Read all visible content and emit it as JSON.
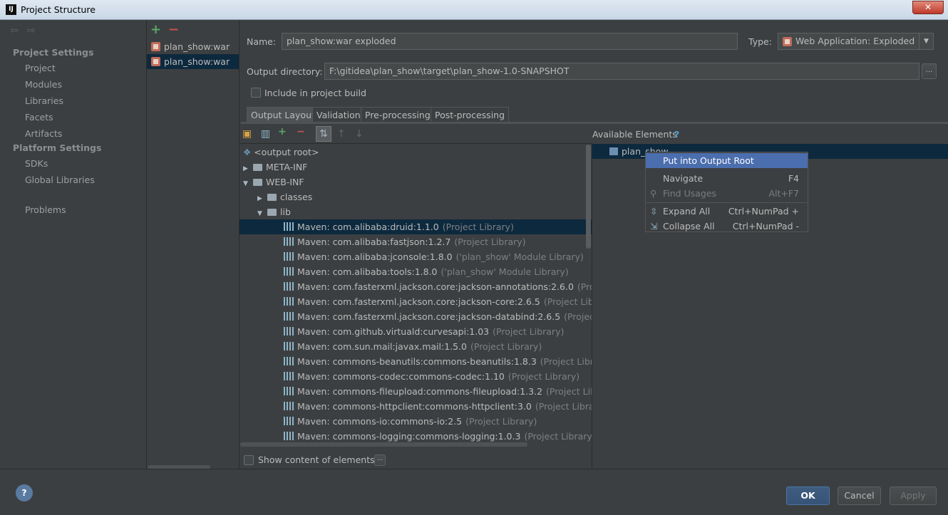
{
  "window": {
    "title": "Project Structure",
    "close": "✕"
  },
  "nav": {
    "project_settings": "Project Settings",
    "project_items": [
      "Project",
      "Modules",
      "Libraries",
      "Facets",
      "Artifacts"
    ],
    "platform_settings": "Platform Settings",
    "platform_items": [
      "SDKs",
      "Global Libraries"
    ],
    "problems": "Problems"
  },
  "artifacts": [
    "plan_show:war",
    "plan_show:war"
  ],
  "form": {
    "name_label": "Name:",
    "name_value": "plan_show:war exploded",
    "type_label": "Type:",
    "type_value": "Web Application: Exploded",
    "output_label": "Output directory:",
    "output_value": "F:\\gitidea\\plan_show\\target\\plan_show-1.0-SNAPSHOT",
    "browse": "...",
    "include_build": "Include in project build"
  },
  "tabs": [
    "Output Layout",
    "Validation",
    "Pre-processing",
    "Post-processing"
  ],
  "available_label": "Available Elements",
  "available_help": "?",
  "tree": {
    "root": "<output root>",
    "meta_inf": "META-INF",
    "web_inf": "WEB-INF",
    "classes": "classes",
    "lib": "lib",
    "libs": [
      {
        "name": "Maven: com.alibaba:druid:1.1.0",
        "scope": "(Project Library)"
      },
      {
        "name": "Maven: com.alibaba:fastjson:1.2.7",
        "scope": "(Project Library)"
      },
      {
        "name": "Maven: com.alibaba:jconsole:1.8.0",
        "scope": "('plan_show' Module Library)"
      },
      {
        "name": "Maven: com.alibaba:tools:1.8.0",
        "scope": "('plan_show' Module Library)"
      },
      {
        "name": "Maven: com.fasterxml.jackson.core:jackson-annotations:2.6.0",
        "scope": "(Project Li"
      },
      {
        "name": "Maven: com.fasterxml.jackson.core:jackson-core:2.6.5",
        "scope": "(Project Library)"
      },
      {
        "name": "Maven: com.fasterxml.jackson.core:jackson-databind:2.6.5",
        "scope": "(Project Libra"
      },
      {
        "name": "Maven: com.github.virtuald:curvesapi:1.03",
        "scope": "(Project Library)"
      },
      {
        "name": "Maven: com.sun.mail:javax.mail:1.5.0",
        "scope": "(Project Library)"
      },
      {
        "name": "Maven: commons-beanutils:commons-beanutils:1.8.3",
        "scope": "(Project Library)"
      },
      {
        "name": "Maven: commons-codec:commons-codec:1.10",
        "scope": "(Project Library)"
      },
      {
        "name": "Maven: commons-fileupload:commons-fileupload:1.3.2",
        "scope": "(Project Library)"
      },
      {
        "name": "Maven: commons-httpclient:commons-httpclient:3.0",
        "scope": "(Project Library)"
      },
      {
        "name": "Maven: commons-io:commons-io:2.5",
        "scope": "(Project Library)"
      },
      {
        "name": "Maven: commons-logging:commons-logging:1.0.3",
        "scope": "(Project Library)"
      }
    ]
  },
  "available": {
    "module": "plan_show"
  },
  "context_menu": {
    "put": "Put into Output Root",
    "navigate": "Navigate",
    "navigate_key": "F4",
    "find": "Find Usages",
    "find_key": "Alt+F7",
    "expand": "Expand All",
    "expand_key": "Ctrl+NumPad +",
    "collapse": "Collapse All",
    "collapse_key": "Ctrl+NumPad -"
  },
  "show_content": "Show content of elements",
  "show_content_btn": "...",
  "buttons": {
    "ok": "OK",
    "cancel": "Cancel",
    "apply": "Apply",
    "help": "?"
  }
}
